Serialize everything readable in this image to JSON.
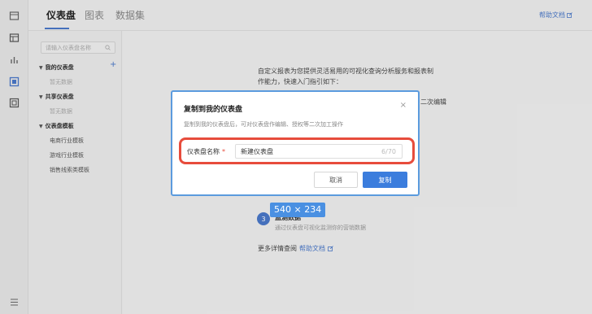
{
  "tabs": {
    "items": [
      "仪表盘",
      "图表",
      "数据集"
    ],
    "help_link": "帮助文档"
  },
  "sidebar": {
    "search_placeholder": "请输入仪表盘名称",
    "tree": {
      "my_group": "我的仪表盘",
      "my_empty": "暂无数据",
      "shared_group": "共享仪表盘",
      "shared_empty": "暂无数据",
      "template_group": "仪表盘模板",
      "templates": [
        "电商行业模板",
        "游戏行业模板",
        "销售线索类模板"
      ]
    }
  },
  "main": {
    "intro": "自定义报表为您提供灵活易用的可视化查询分析服务和报表制作能力，快速入门指引如下：",
    "edit_note": "二次编辑",
    "step3_number": "3",
    "step3_title": "监测数据",
    "step3_desc": "通过仪表盘可视化监测你的营销数据",
    "more_prefix": "更多详情查阅",
    "more_link": "帮助文档"
  },
  "size_badge": "540 × 234",
  "modal": {
    "title": "复制到我的仪表盘",
    "close": "×",
    "desc": "复制到我的仪表盘后，可对仪表盘作编辑、授权等二次加工操作",
    "field_label": "仪表盘名称",
    "required_mark": "*",
    "field_value": "新建仪表盘",
    "field_count": "6/70",
    "cancel": "取消",
    "confirm": "复制"
  }
}
